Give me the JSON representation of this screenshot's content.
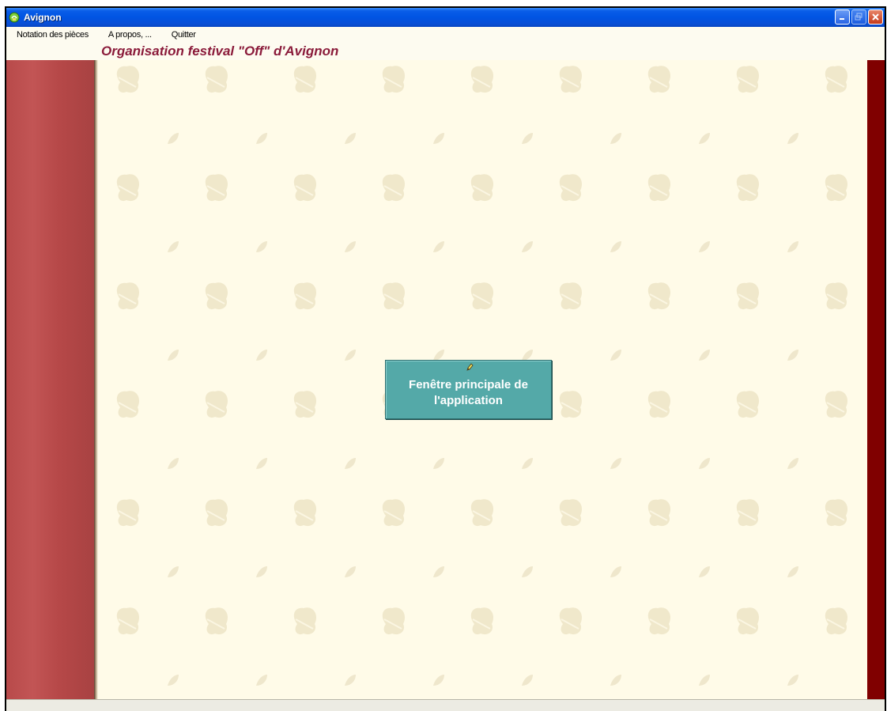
{
  "window": {
    "title": "Avignon",
    "icon": "app-icon",
    "controls": [
      "minimize-icon",
      "restore-icon",
      "close-icon"
    ]
  },
  "menu": {
    "items": [
      {
        "label": "Notation des pièces"
      },
      {
        "label": "A propos, ..."
      },
      {
        "label": "Quitter"
      }
    ]
  },
  "header": {
    "title": "Organisation festival \"Off\" d'Avignon"
  },
  "main": {
    "button_label": "Fenêtre principale de\nl'application",
    "button_icon": "pencil-icon"
  },
  "colors": {
    "titlebar": "#0054e3",
    "accent_title": "#8a1a3a",
    "left_band": "#b84a4a",
    "right_band": "#800000",
    "background": "#fffbe8",
    "button": "#54a9a8"
  }
}
